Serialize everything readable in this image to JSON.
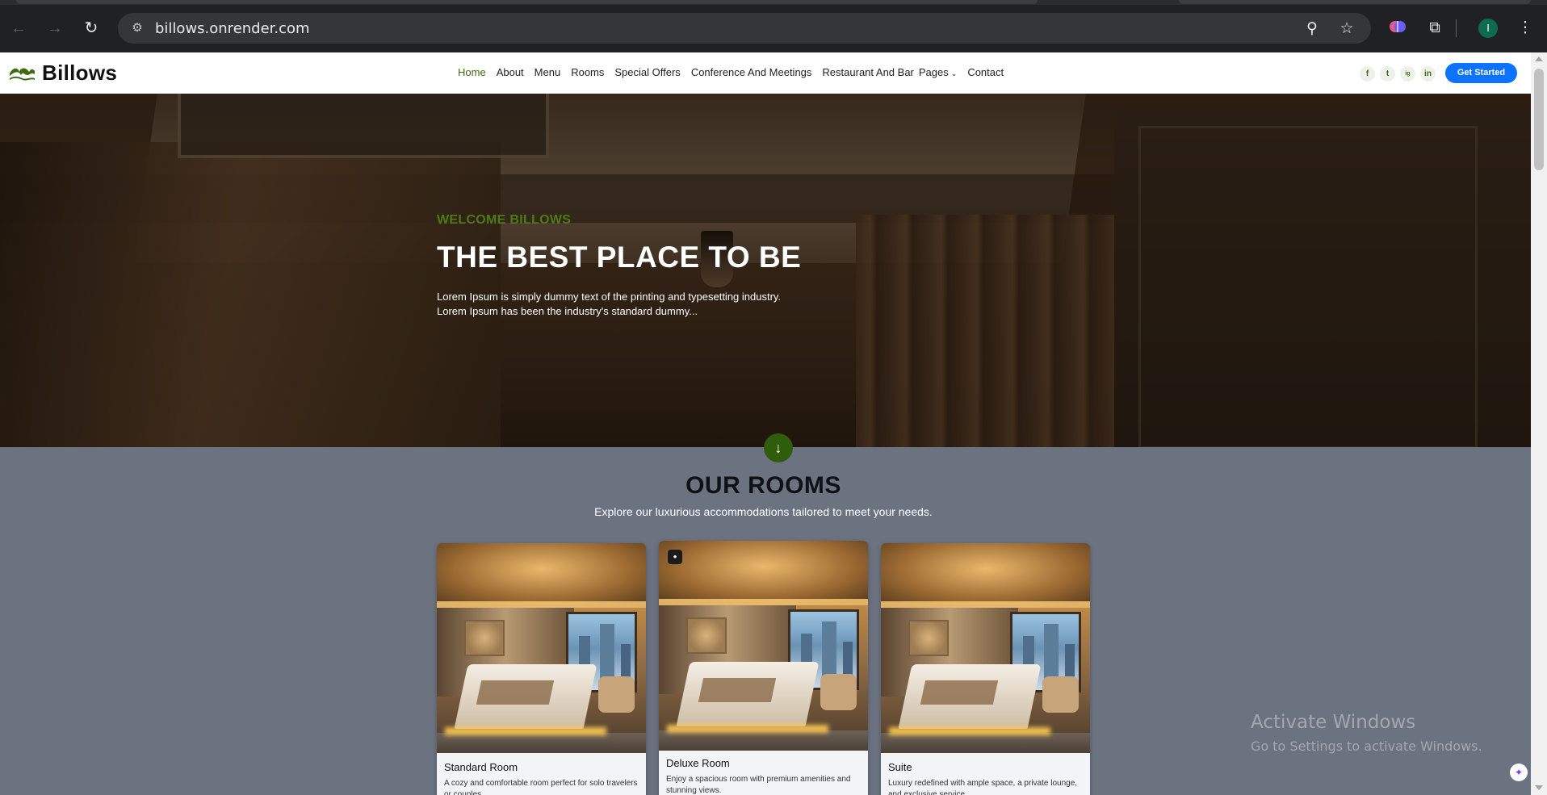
{
  "browser": {
    "url": "billows.onrender.com",
    "profile_initial": "I",
    "icons": [
      "back-arrow-icon",
      "forward-arrow-icon",
      "reload-icon",
      "site-info-icon",
      "zoom-icon",
      "bookmark-star-icon",
      "extension-brain-icon",
      "puzzle-icon",
      "kebab-menu-icon"
    ]
  },
  "header": {
    "logo_text": "Billows",
    "nav": [
      {
        "label": "Home",
        "active": true
      },
      {
        "label": "About"
      },
      {
        "label": "Menu"
      },
      {
        "label": "Rooms"
      },
      {
        "label": "Special Offers"
      },
      {
        "label": "Conference And Meetings"
      },
      {
        "label": "Restaurant And Bar"
      },
      {
        "label": "Pages",
        "has_dropdown": true
      },
      {
        "label": "Contact"
      }
    ],
    "social": [
      "f",
      "t",
      "ig",
      "in"
    ],
    "cta_label": "Get Started",
    "colors": {
      "accent": "#3d6b12",
      "cta": "#0b73ff"
    }
  },
  "hero": {
    "kicker": "WELCOME BILLOWS",
    "title": "THE BEST PLACE TO BE",
    "description": "Lorem Ipsum is simply dummy text of the printing and typesetting industry. Lorem Ipsum has been the industry's standard dummy...",
    "scroll_icon": "↓"
  },
  "rooms": {
    "title": "OUR ROOMS",
    "subtitle": "Explore our luxurious accommodations tailored to meet your needs.",
    "cards": [
      {
        "name": "Standard Room",
        "desc": "A cozy and comfortable room perfect for solo travelers or couples."
      },
      {
        "name": "Deluxe Room",
        "desc": "Enjoy a spacious room with premium amenities and stunning views."
      },
      {
        "name": "Suite",
        "desc": "Luxury redefined with ample space, a private lounge, and exclusive service."
      }
    ]
  },
  "watermark": {
    "title": "Activate Windows",
    "subtitle": "Go to Settings to activate Windows."
  }
}
